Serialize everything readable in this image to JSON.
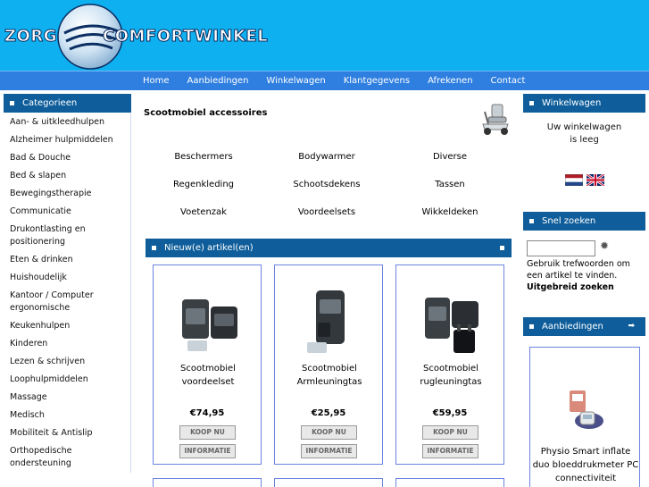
{
  "header": {
    "logo_left": "ZORG",
    "logo_right": "COMFORTWINKEL"
  },
  "nav": [
    "Home",
    "Aanbiedingen",
    "Winkelwagen",
    "Klantgegevens",
    "Afrekenen",
    "Contact"
  ],
  "categories": {
    "title": "Categorieen",
    "items": [
      "Aan- & uitkleedhulpen",
      "Alzheimer hulpmiddelen",
      "Bad & Douche",
      "Bed & slapen",
      "Bewegingstherapie",
      "Communicatie",
      "Drukontlasting en positionering",
      "Eten & drinken",
      "Huishoudelijk",
      "Kantoor / Computer ergonomische",
      "Keukenhulpen",
      "Kinderen",
      "Lezen & schrijven",
      "Loophulpmiddelen",
      "Massage",
      "Medisch",
      "Mobiliteit & Antislip",
      "Orthopedische ondersteuning"
    ]
  },
  "main": {
    "title": "Scootmobiel accessoires",
    "subcategories": [
      [
        "Beschermers",
        "Bodywarmer",
        "Diverse"
      ],
      [
        "Regenkleding",
        "Schootsdekens",
        "Tassen"
      ],
      [
        "Voetenzak",
        "Voordeelsets",
        "Wikkeldeken"
      ]
    ],
    "new_title": "Nieuw(e) artikel(en)",
    "products": [
      {
        "name": "Scootmobiel voordeelset",
        "price": "€74,95",
        "buy": "KOOP NU",
        "info": "INFORMATIE"
      },
      {
        "name": "Scootmobiel Armleuningtas",
        "price": "€25,95",
        "buy": "KOOP NU",
        "info": "INFORMATIE"
      },
      {
        "name": "Scootmobiel rugleuningtas",
        "price": "€59,95",
        "buy": "KOOP NU",
        "info": "INFORMATIE"
      }
    ]
  },
  "cart": {
    "title": "Winkelwagen",
    "line1": "Uw winkelwagen",
    "line2": "is leeg"
  },
  "quicksearch": {
    "title": "Snel zoeken",
    "value": "",
    "help": "Gebruik trefwoorden om een artikel te vinden.",
    "advanced": "Uitgebreid zoeken"
  },
  "offers": {
    "title": "Aanbiedingen",
    "arrow": "➡",
    "product_name": "Physio Smart inflate duo bloeddrukmeter PC connectiviteit"
  },
  "colors": {
    "header_bg": "#0eb0f0",
    "nav_bg": "#2f7fe0",
    "section_head": "#0f5e9b",
    "card_border": "#6b83e0"
  }
}
